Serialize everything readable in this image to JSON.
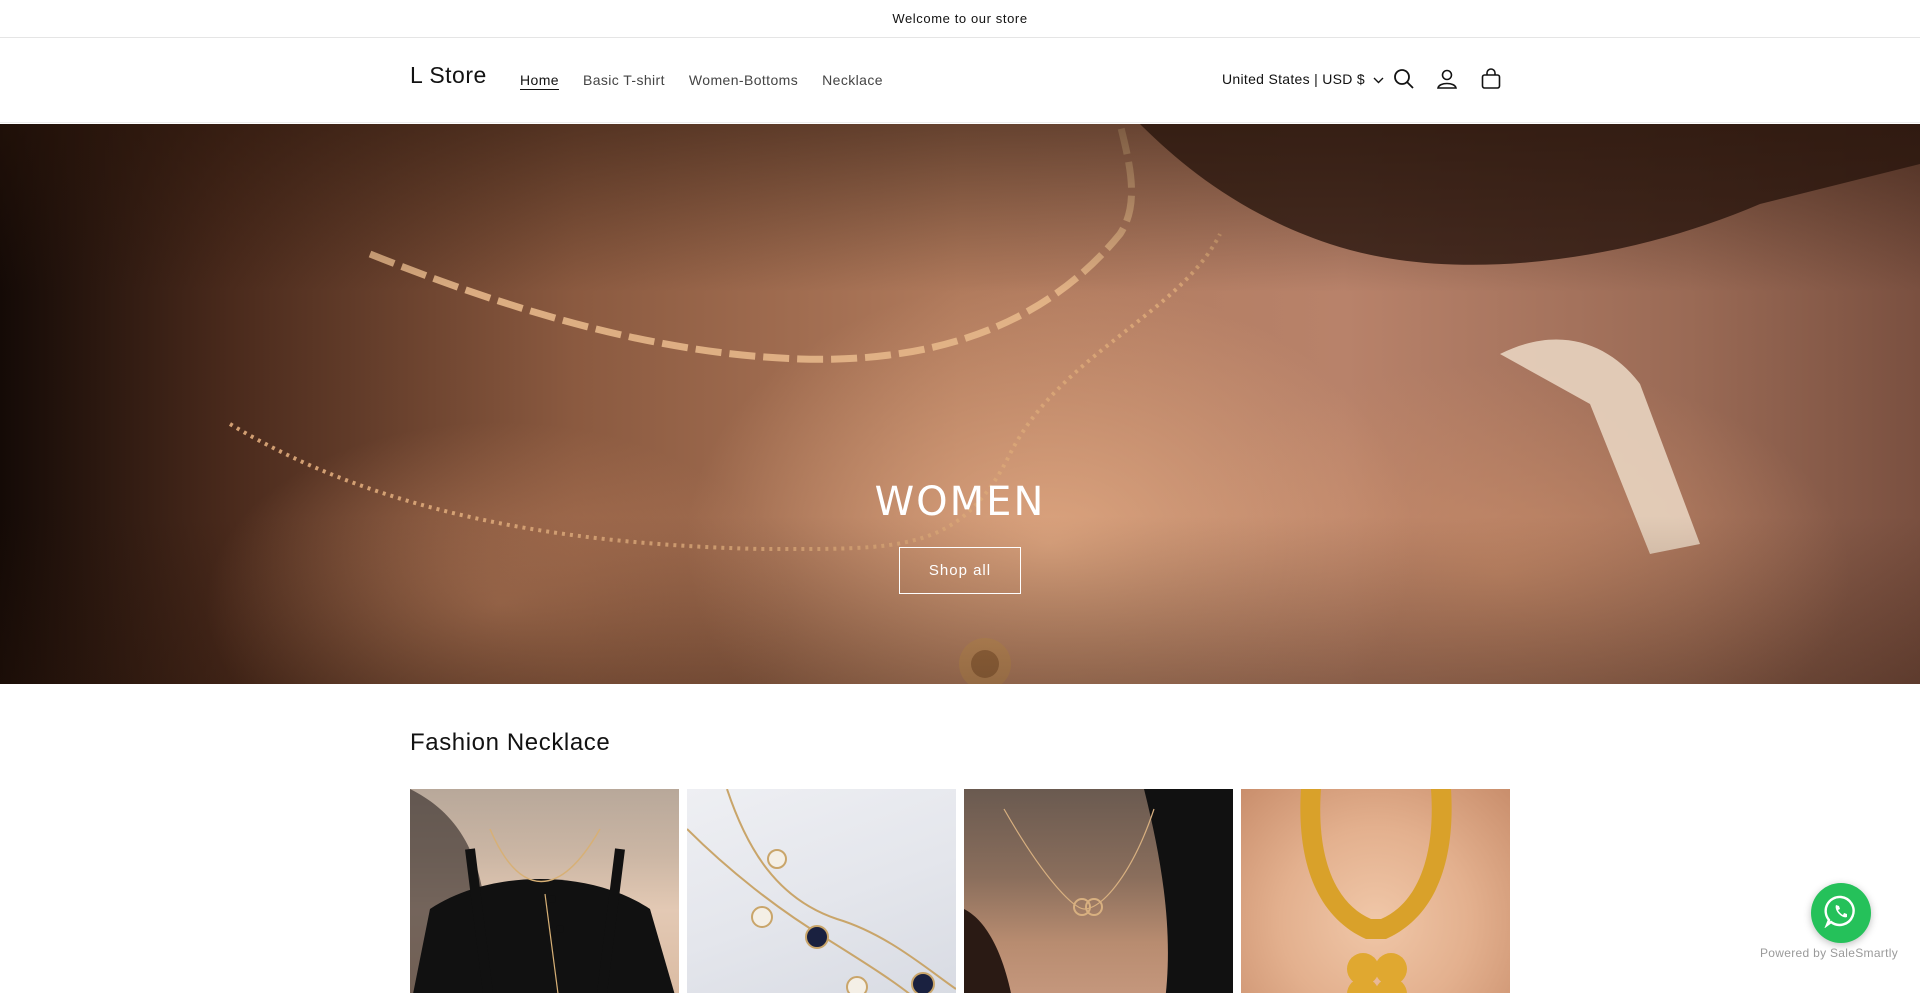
{
  "announcement": {
    "text": "Welcome to our store"
  },
  "header": {
    "logo": "L Store",
    "nav": [
      {
        "label": "Home",
        "active": true
      },
      {
        "label": "Basic T-shirt",
        "active": false
      },
      {
        "label": "Women-Bottoms",
        "active": false
      },
      {
        "label": "Necklace",
        "active": false
      }
    ],
    "country_selector": "United States | USD $",
    "icons": [
      "search-icon",
      "account-icon",
      "cart-icon"
    ]
  },
  "hero": {
    "title": "WOMEN",
    "button_label": "Shop all"
  },
  "collection": {
    "title": "Fashion Necklace",
    "products": [
      {
        "image": "necklace-on-model-black-top"
      },
      {
        "image": "gold-clover-necklace"
      },
      {
        "image": "interlocking-hearts-necklace"
      },
      {
        "image": "gold-snake-chain-clover-pendant"
      }
    ]
  },
  "chat_widget": {
    "icon": "whatsapp-icon",
    "color": "#25c15a",
    "powered_by": "Powered by SaleSmartly"
  }
}
